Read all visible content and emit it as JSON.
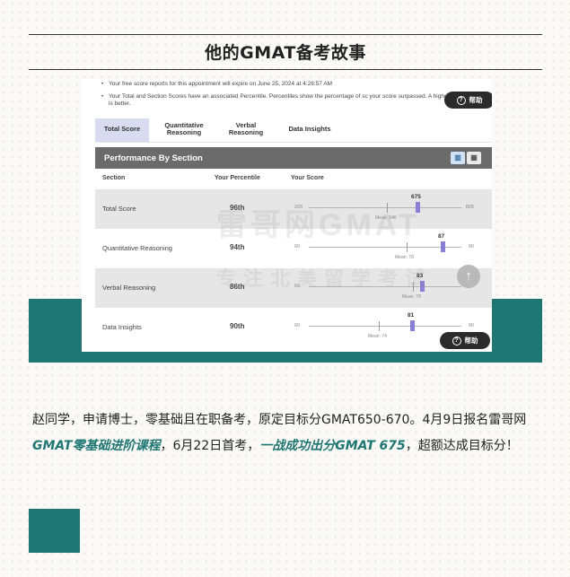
{
  "article": {
    "title": "他的GMAT备考故事",
    "story": {
      "p1": "赵同学，申请博士，零基础且在职备考，原定目标分GMAT650-670。4月9日报名雷哥网",
      "h1": "GMAT零基础进阶课程",
      "p2": "，6月22日首考，",
      "h2": "一战成功出分GMAT 675",
      "p3": "，超额达成目标分！"
    }
  },
  "score_report": {
    "notes": [
      "Your free score reports for this appointment will expire on June 25, 2024 at 4:28:57 AM",
      "Your Total and Section Scores have an associated Percentile. Percentiles show the percentage of sc your score surpassed. A higher percentile is better."
    ],
    "help_label": "帮助",
    "tabs": [
      "Total Score",
      "Quantitative Reasoning",
      "Verbal Reasoning",
      "Data Insights"
    ],
    "active_tab": "Total Score",
    "panel_title": "Performance By Section",
    "columns": [
      "Section",
      "Your Percentile",
      "Your Score"
    ],
    "rows": [
      {
        "section": "Total Score",
        "percentile": "96th",
        "score": "675",
        "min": "205",
        "max": "805",
        "mean": "Mean: 546"
      },
      {
        "section": "Quantitative Reasoning",
        "percentile": "94th",
        "score": "87",
        "min": "60",
        "max": "90",
        "mean": "Mean: 78"
      },
      {
        "section": "Verbal Reasoning",
        "percentile": "86th",
        "score": "83",
        "min": "60",
        "max": "90",
        "mean": "Mean: 79"
      },
      {
        "section": "Data Insights",
        "percentile": "90th",
        "score": "81",
        "min": "60",
        "max": "90",
        "mean": "Mean: 74"
      }
    ]
  },
  "watermark": {
    "line1": "雷哥网GMAT",
    "line2": "专注北美留学考试"
  },
  "colors": {
    "accent": "#1f7673",
    "marker": "#8a7fd6",
    "panel_header": "#6b6b6b"
  },
  "icons": [
    "help-circle-icon",
    "bar-chart-view-icon",
    "table-view-icon",
    "arrow-up-icon"
  ]
}
